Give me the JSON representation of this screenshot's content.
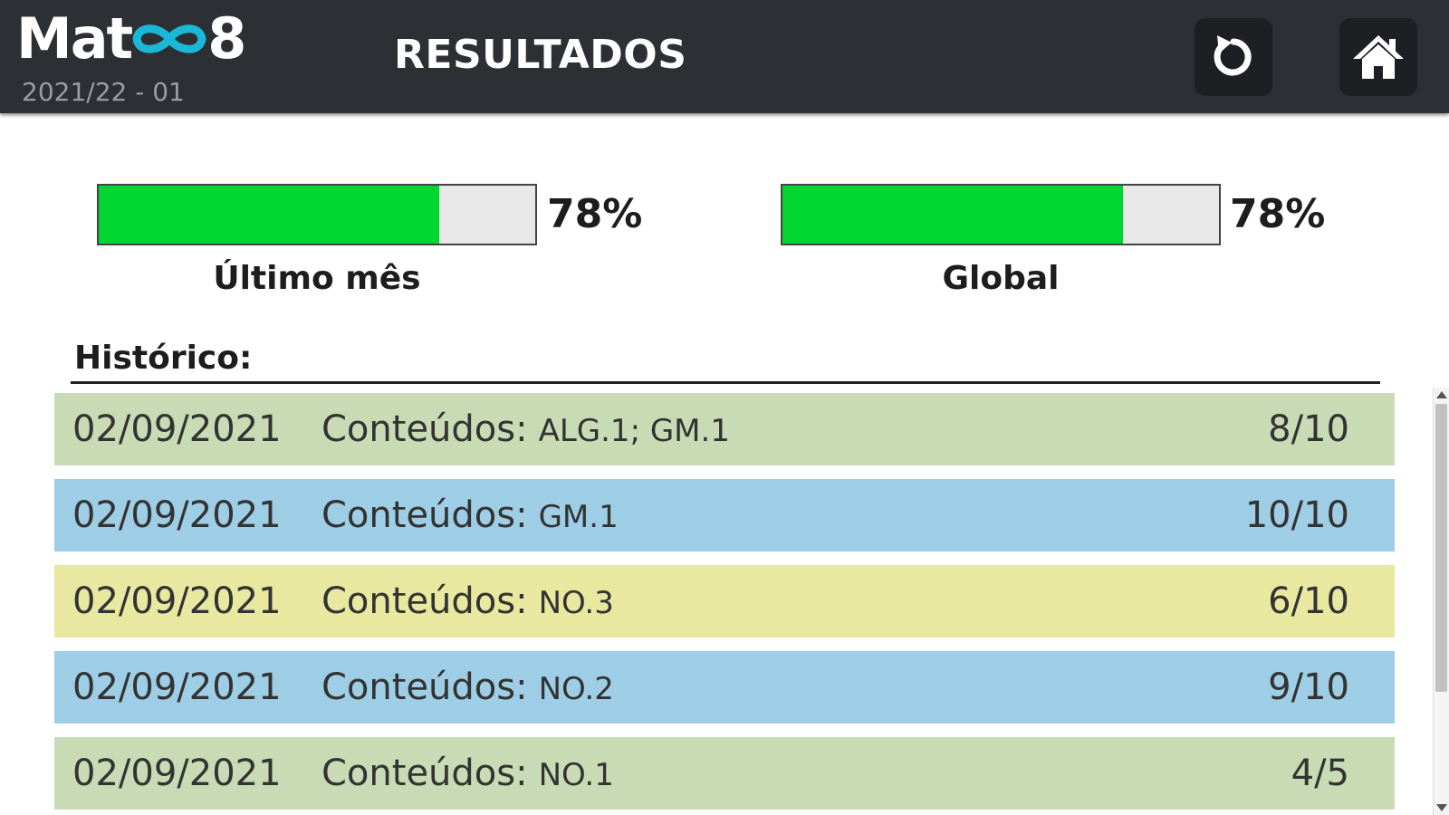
{
  "header": {
    "logo_left": "Mat",
    "logo_right": "8",
    "logo_icon": "infinity-icon",
    "year": "2021/22 - 01",
    "title": "RESULTADOS",
    "refresh_icon": "refresh-icon",
    "home_icon": "home-icon"
  },
  "progress": [
    {
      "percent_text": "78%",
      "value": 0.78,
      "label": "Último mês"
    },
    {
      "percent_text": "78%",
      "value": 0.78,
      "label": "Global"
    }
  ],
  "history": {
    "title": "Histórico:",
    "rows": [
      {
        "date": "02/09/2021",
        "content_label": "Conteúdos:",
        "content_value": "ALG.1; GM.1",
        "score": "8/10",
        "color": "#c8dbb4"
      },
      {
        "date": "02/09/2021",
        "content_label": "Conteúdos:",
        "content_value": "GM.1",
        "score": "10/10",
        "color": "#9ecee6"
      },
      {
        "date": "02/09/2021",
        "content_label": "Conteúdos:",
        "content_value": "NO.3",
        "score": "6/10",
        "color": "#e8e8a0"
      },
      {
        "date": "02/09/2021",
        "content_label": "Conteúdos:",
        "content_value": "NO.2",
        "score": "9/10",
        "color": "#9ecee6"
      },
      {
        "date": "02/09/2021",
        "content_label": "Conteúdos:",
        "content_value": "NO.1",
        "score": "4/5",
        "color": "#c8dbb4"
      }
    ]
  },
  "colors": {
    "header_bg": "#2c2f33",
    "progress_fill": "#00d62f",
    "progress_empty": "#e8e8e8",
    "logo_accent": "#1ab8d6"
  }
}
